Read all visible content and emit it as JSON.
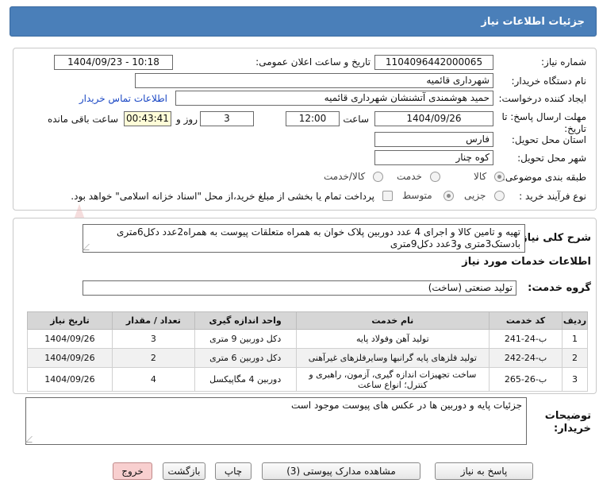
{
  "header": {
    "title": "جزئیات اطلاعات نیاز"
  },
  "info": {
    "need_number_label": "شماره نیاز:",
    "need_number": "1104096442000065",
    "announce_label": "تاریخ و ساعت اعلان عمومی:",
    "announce_value": "1404/09/23 - 10:18",
    "buyer_org_label": "نام دستگاه خریدار:",
    "buyer_org": "شهرداری قائمیه",
    "requester_label": "ایجاد کننده درخواست:",
    "requester": "حمید هوشمندی آتشنشان شهرداری قائمیه",
    "contact_link": "اطلاعات تماس خریدار",
    "deadline_label": "مهلت ارسال پاسخ: تا تاریخ:",
    "deadline_date": "1404/09/26",
    "time_label": "ساعت",
    "deadline_time": "12:00",
    "days_value": "3",
    "days_label": "روز و",
    "remaining_time": "00:43:41",
    "remaining_label": "ساعت باقی مانده",
    "province_label": "استان محل تحویل:",
    "province": "فارس",
    "city_label": "شهر محل تحویل:",
    "city": "کوه چنار",
    "category_label": "طبقه بندی موضوعی:",
    "category_options": [
      "کالا",
      "خدمت",
      "کالا/خدمت"
    ],
    "category_selected": "کالا",
    "process_label": "نوع فرآیند خرید :",
    "process_options": [
      "جزیی",
      "متوسط"
    ],
    "process_selected": "متوسط",
    "payment_note": "پرداخت تمام یا بخشی از مبلغ خرید،از محل \"اسناد خزانه اسلامی\" خواهد بود."
  },
  "general": {
    "desc_label": "شرح کلی نیاز:",
    "description": "تهیه و تامین کالا و اجرای 4 عدد دوربین پلاک خوان به همراه متعلقات پیوست به همراه2عدد دکل6متری بادستک3متری و3عدد دکل9متری",
    "services_heading": "اطلاعات خدمات مورد نیاز",
    "service_group_label": "گروه خدمت:",
    "service_group": "تولید صنعتی (ساخت)"
  },
  "table": {
    "columns": [
      "ردیف",
      "کد خدمت",
      "نام خدمت",
      "واحد اندازه گیری",
      "تعداد / مقدار",
      "تاریخ نیاز"
    ],
    "rows": [
      [
        "1",
        "ب-24-241",
        "تولید آهن وفولاد پایه",
        "دکل دوربین 9 متری",
        "3",
        "1404/09/26"
      ],
      [
        "2",
        "ب-24-242",
        "تولید فلزهای پایه گرانبها وسایرفلزهای غیرآهنی",
        "دکل دوربین 6 متری",
        "2",
        "1404/09/26"
      ],
      [
        "3",
        "ب-26-265",
        "ساخت تجهیزات اندازه گیری، آزمون، راهبری و کنترل؛ انواع ساعت",
        "دوربین 4 مگاپیکسل",
        "4",
        "1404/09/26"
      ]
    ]
  },
  "buyer_notes": {
    "label": "توضیحات خریدار:",
    "text": "جزئیات پایه و دوربین ها در عکس های پیوست موجود است"
  },
  "buttons": {
    "reply": "پاسخ به نیاز",
    "attachments": "مشاهده مدارک پیوستی (3)",
    "print": "چاپ",
    "back": "بازگشت",
    "exit": "خروج"
  },
  "colors": {
    "title_bar": "#4a7fb9",
    "timer_bg": "#fffdd8",
    "exit_bg": "#f8cfcf",
    "watermark": "#e8b4b4"
  },
  "watermark": {
    "text": "AriaTender.net"
  }
}
